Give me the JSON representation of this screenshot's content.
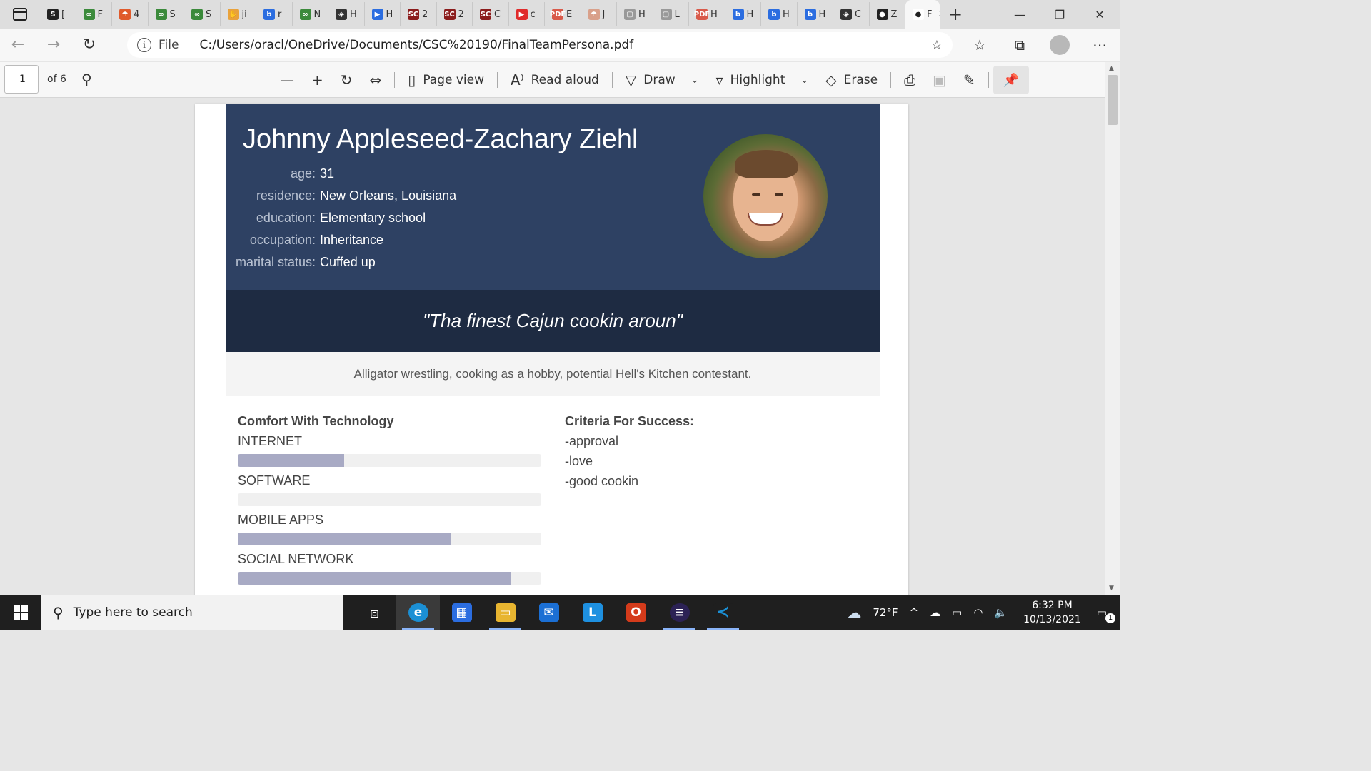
{
  "browser": {
    "tabs": [
      {
        "icon": "S",
        "label": "[",
        "color": "#222"
      },
      {
        "icon": "∞",
        "label": "F",
        "color": "#3b8a3b"
      },
      {
        "icon": "☂",
        "label": "4",
        "color": "#e05a2b"
      },
      {
        "icon": "∞",
        "label": "S",
        "color": "#3b8a3b"
      },
      {
        "icon": "∞",
        "label": "S",
        "color": "#3b8a3b"
      },
      {
        "icon": "✋",
        "label": "ji",
        "color": "#e9a23b"
      },
      {
        "icon": "b",
        "label": "r",
        "color": "#2b6de0"
      },
      {
        "icon": "∞",
        "label": "N",
        "color": "#3b8a3b"
      },
      {
        "icon": "◈",
        "label": "H",
        "color": "#333"
      },
      {
        "icon": "▶",
        "label": "H",
        "color": "#2b6de0"
      },
      {
        "icon": "SC",
        "label": "2",
        "color": "#8b1c1c"
      },
      {
        "icon": "SC",
        "label": "2",
        "color": "#8b1c1c"
      },
      {
        "icon": "SC",
        "label": "C",
        "color": "#8b1c1c"
      },
      {
        "icon": "▶",
        "label": "c",
        "color": "#e02b2b"
      },
      {
        "icon": "PDF",
        "label": "E",
        "color": "#d95a4a"
      },
      {
        "icon": "☂",
        "label": "J",
        "color": "#d9a08a"
      },
      {
        "icon": "▢",
        "label": "H",
        "color": "#999"
      },
      {
        "icon": "▢",
        "label": "L",
        "color": "#999"
      },
      {
        "icon": "PDF",
        "label": "H",
        "color": "#d95a4a"
      },
      {
        "icon": "b",
        "label": "H",
        "color": "#2b6de0"
      },
      {
        "icon": "b",
        "label": "H",
        "color": "#2b6de0"
      },
      {
        "icon": "b",
        "label": "H",
        "color": "#2b6de0"
      },
      {
        "icon": "◈",
        "label": "C",
        "color": "#333"
      },
      {
        "icon": "●",
        "label": "Z",
        "color": "#222"
      }
    ],
    "active_tab_label": "F",
    "address": {
      "scheme_label": "File",
      "url": "C:/Users/oracl/OneDrive/Documents/CSC%20190/FinalTeamPersona.pdf"
    }
  },
  "pdf_toolbar": {
    "page_number": "1",
    "page_total": "of 6",
    "page_view": "Page view",
    "read_aloud": "Read aloud",
    "draw": "Draw",
    "highlight": "Highlight",
    "erase": "Erase"
  },
  "persona": {
    "name": "Johnny Appleseed-Zachary Ziehl",
    "attributes": [
      {
        "key": "age:",
        "value": "31"
      },
      {
        "key": "residence:",
        "value": "New Orleans, Louisiana"
      },
      {
        "key": "education:",
        "value": "Elementary school"
      },
      {
        "key": "occupation:",
        "value": "Inheritance"
      },
      {
        "key": "marital status:",
        "value": "Cuffed up"
      }
    ],
    "quote": "\"Tha finest Cajun cookin aroun\"",
    "bio": "Alligator wrestling, cooking as a hobby, potential Hell's Kitchen contestant.",
    "comfort_title": "Comfort With Technology",
    "comfort": [
      {
        "label": "INTERNET",
        "level": 0.35
      },
      {
        "label": "SOFTWARE",
        "level": 0.0
      },
      {
        "label": "MOBILE APPS",
        "level": 0.7
      },
      {
        "label": "SOCIAL NETWORK",
        "level": 0.9
      }
    ],
    "criteria_title": "Criteria For Success:",
    "criteria": [
      "-approval",
      "-love",
      "-good cookin"
    ]
  },
  "taskbar": {
    "search_placeholder": "Type here to search",
    "weather": "72°F",
    "time": "6:32 PM",
    "date": "10/13/2021",
    "notifications": "1"
  },
  "colors": {
    "header_bg": "#2e4163",
    "quote_bg": "#1e2b42",
    "bar_fill": "#a8aac4"
  }
}
